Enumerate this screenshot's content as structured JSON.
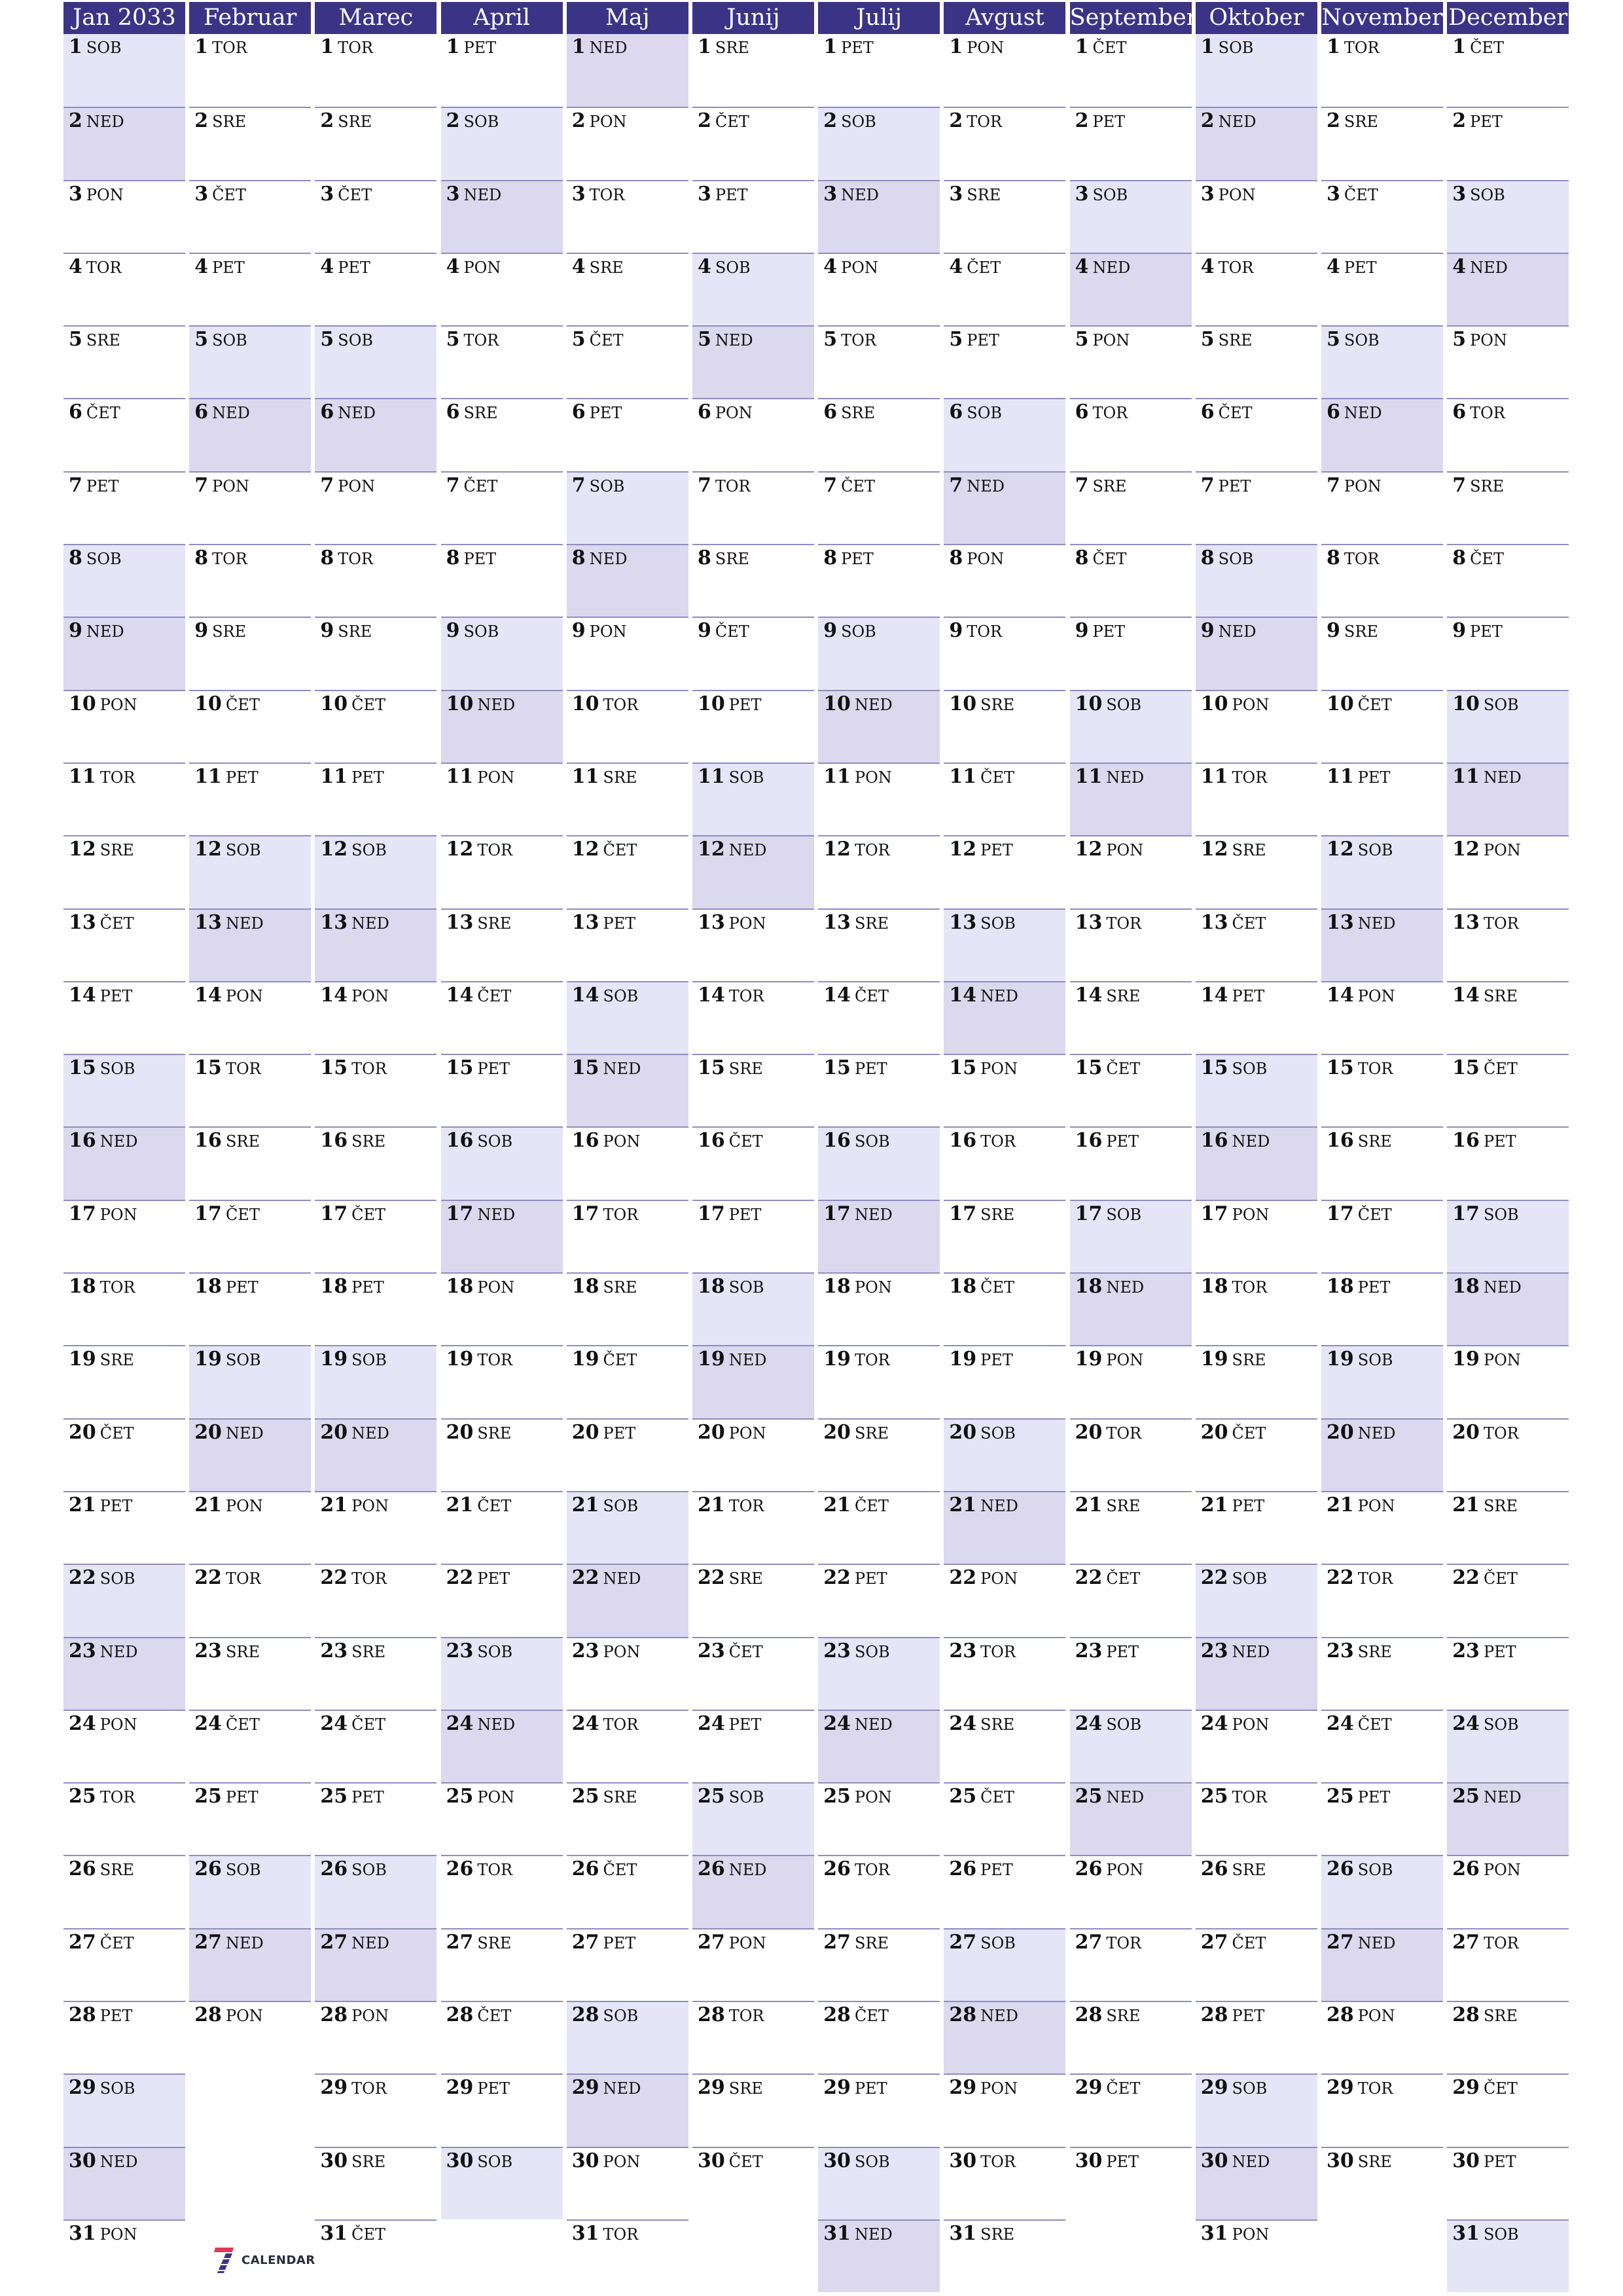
{
  "colors": {
    "header_bg": "#3b3486",
    "header_text": "#ffffff",
    "saturday_bg": "#e5e5f7",
    "sunday_bg": "#dcd8ee",
    "divider": "#8f8cc0",
    "logo_red": "#e8345a",
    "logo_blue": "#3b3486"
  },
  "logo": {
    "text": "CALENDAR",
    "icon": "seven-calendar-logo-icon"
  },
  "weekend": {
    "saturday": "SOB",
    "sunday": "NED"
  },
  "months": [
    {
      "name": "Jan 2033",
      "days": [
        "SOB",
        "NED",
        "PON",
        "TOR",
        "SRE",
        "ČET",
        "PET",
        "SOB",
        "NED",
        "PON",
        "TOR",
        "SRE",
        "ČET",
        "PET",
        "SOB",
        "NED",
        "PON",
        "TOR",
        "SRE",
        "ČET",
        "PET",
        "SOB",
        "NED",
        "PON",
        "TOR",
        "SRE",
        "ČET",
        "PET",
        "SOB",
        "NED",
        "PON"
      ]
    },
    {
      "name": "Februar",
      "days": [
        "TOR",
        "SRE",
        "ČET",
        "PET",
        "SOB",
        "NED",
        "PON",
        "TOR",
        "SRE",
        "ČET",
        "PET",
        "SOB",
        "NED",
        "PON",
        "TOR",
        "SRE",
        "ČET",
        "PET",
        "SOB",
        "NED",
        "PON",
        "TOR",
        "SRE",
        "ČET",
        "PET",
        "SOB",
        "NED",
        "PON"
      ]
    },
    {
      "name": "Marec",
      "days": [
        "TOR",
        "SRE",
        "ČET",
        "PET",
        "SOB",
        "NED",
        "PON",
        "TOR",
        "SRE",
        "ČET",
        "PET",
        "SOB",
        "NED",
        "PON",
        "TOR",
        "SRE",
        "ČET",
        "PET",
        "SOB",
        "NED",
        "PON",
        "TOR",
        "SRE",
        "ČET",
        "PET",
        "SOB",
        "NED",
        "PON",
        "TOR",
        "SRE",
        "ČET"
      ]
    },
    {
      "name": "April",
      "days": [
        "PET",
        "SOB",
        "NED",
        "PON",
        "TOR",
        "SRE",
        "ČET",
        "PET",
        "SOB",
        "NED",
        "PON",
        "TOR",
        "SRE",
        "ČET",
        "PET",
        "SOB",
        "NED",
        "PON",
        "TOR",
        "SRE",
        "ČET",
        "PET",
        "SOB",
        "NED",
        "PON",
        "TOR",
        "SRE",
        "ČET",
        "PET",
        "SOB"
      ]
    },
    {
      "name": "Maj",
      "days": [
        "NED",
        "PON",
        "TOR",
        "SRE",
        "ČET",
        "PET",
        "SOB",
        "NED",
        "PON",
        "TOR",
        "SRE",
        "ČET",
        "PET",
        "SOB",
        "NED",
        "PON",
        "TOR",
        "SRE",
        "ČET",
        "PET",
        "SOB",
        "NED",
        "PON",
        "TOR",
        "SRE",
        "ČET",
        "PET",
        "SOB",
        "NED",
        "PON",
        "TOR"
      ]
    },
    {
      "name": "Junij",
      "days": [
        "SRE",
        "ČET",
        "PET",
        "SOB",
        "NED",
        "PON",
        "TOR",
        "SRE",
        "ČET",
        "PET",
        "SOB",
        "NED",
        "PON",
        "TOR",
        "SRE",
        "ČET",
        "PET",
        "SOB",
        "NED",
        "PON",
        "TOR",
        "SRE",
        "ČET",
        "PET",
        "SOB",
        "NED",
        "PON",
        "TOR",
        "SRE",
        "ČET"
      ]
    },
    {
      "name": "Julij",
      "days": [
        "PET",
        "SOB",
        "NED",
        "PON",
        "TOR",
        "SRE",
        "ČET",
        "PET",
        "SOB",
        "NED",
        "PON",
        "TOR",
        "SRE",
        "ČET",
        "PET",
        "SOB",
        "NED",
        "PON",
        "TOR",
        "SRE",
        "ČET",
        "PET",
        "SOB",
        "NED",
        "PON",
        "TOR",
        "SRE",
        "ČET",
        "PET",
        "SOB",
        "NED"
      ]
    },
    {
      "name": "Avgust",
      "days": [
        "PON",
        "TOR",
        "SRE",
        "ČET",
        "PET",
        "SOB",
        "NED",
        "PON",
        "TOR",
        "SRE",
        "ČET",
        "PET",
        "SOB",
        "NED",
        "PON",
        "TOR",
        "SRE",
        "ČET",
        "PET",
        "SOB",
        "NED",
        "PON",
        "TOR",
        "SRE",
        "ČET",
        "PET",
        "SOB",
        "NED",
        "PON",
        "TOR",
        "SRE"
      ]
    },
    {
      "name": "September",
      "days": [
        "ČET",
        "PET",
        "SOB",
        "NED",
        "PON",
        "TOR",
        "SRE",
        "ČET",
        "PET",
        "SOB",
        "NED",
        "PON",
        "TOR",
        "SRE",
        "ČET",
        "PET",
        "SOB",
        "NED",
        "PON",
        "TOR",
        "SRE",
        "ČET",
        "PET",
        "SOB",
        "NED",
        "PON",
        "TOR",
        "SRE",
        "ČET",
        "PET"
      ]
    },
    {
      "name": "Oktober",
      "days": [
        "SOB",
        "NED",
        "PON",
        "TOR",
        "SRE",
        "ČET",
        "PET",
        "SOB",
        "NED",
        "PON",
        "TOR",
        "SRE",
        "ČET",
        "PET",
        "SOB",
        "NED",
        "PON",
        "TOR",
        "SRE",
        "ČET",
        "PET",
        "SOB",
        "NED",
        "PON",
        "TOR",
        "SRE",
        "ČET",
        "PET",
        "SOB",
        "NED",
        "PON"
      ]
    },
    {
      "name": "November",
      "days": [
        "TOR",
        "SRE",
        "ČET",
        "PET",
        "SOB",
        "NED",
        "PON",
        "TOR",
        "SRE",
        "ČET",
        "PET",
        "SOB",
        "NED",
        "PON",
        "TOR",
        "SRE",
        "ČET",
        "PET",
        "SOB",
        "NED",
        "PON",
        "TOR",
        "SRE",
        "ČET",
        "PET",
        "SOB",
        "NED",
        "PON",
        "TOR",
        "SRE"
      ]
    },
    {
      "name": "December",
      "days": [
        "ČET",
        "PET",
        "SOB",
        "NED",
        "PON",
        "TOR",
        "SRE",
        "ČET",
        "PET",
        "SOB",
        "NED",
        "PON",
        "TOR",
        "SRE",
        "ČET",
        "PET",
        "SOB",
        "NED",
        "PON",
        "TOR",
        "SRE",
        "ČET",
        "PET",
        "SOB",
        "NED",
        "PON",
        "TOR",
        "SRE",
        "ČET",
        "PET",
        "SOB"
      ]
    }
  ]
}
